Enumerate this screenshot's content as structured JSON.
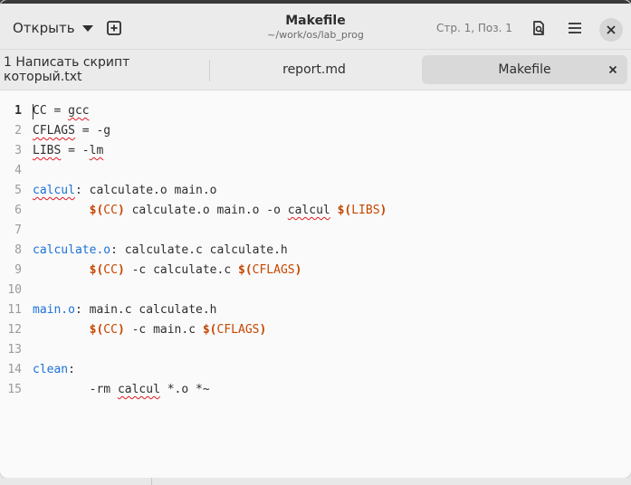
{
  "header": {
    "open_label": "Открыть",
    "title": "Makefile",
    "subtitle": "~/work/os/lab_prog",
    "position": "Стр. 1, Поз. 1"
  },
  "icons": {
    "new_tab": "new-tab-icon",
    "document_search": "document-search-icon",
    "menu": "hamburger-menu-icon",
    "close": "close-icon"
  },
  "tabs": [
    {
      "label": "1 Написать скрипт который.txt",
      "active": false
    },
    {
      "label": "report.md",
      "active": false
    },
    {
      "label": "Makefile",
      "active": true
    }
  ],
  "editor": {
    "line_numbers": [
      "1",
      "2",
      "3",
      "4",
      "5",
      "6",
      "7",
      "8",
      "9",
      "10",
      "11",
      "12",
      "13",
      "14",
      "15"
    ],
    "current_line": "1"
  },
  "code_lines": {
    "l1": {
      "a": "CC",
      "b": " = ",
      "c": "gcc"
    },
    "l2": {
      "a": "CFLAGS",
      "b": " = -g"
    },
    "l3": {
      "a": "LIBS",
      "b": " = -",
      "c": "lm"
    },
    "l5": {
      "target": "calcul",
      "rest": ": calculate.o main.o"
    },
    "l6": {
      "indent": "        ",
      "d1": "$(",
      "v1": "CC",
      "d2": ")",
      "mid": " calculate.o main.o -o ",
      "sp": "calcul",
      "sp2": " ",
      "d3": "$(",
      "v2": "LIBS",
      "d4": ")"
    },
    "l8": {
      "target": "calculate.o",
      "rest": ": calculate.c calculate.h"
    },
    "l9": {
      "indent": "        ",
      "d1": "$(",
      "v1": "CC",
      "d2": ")",
      "mid": " -c calculate.c ",
      "d3": "$(",
      "v2": "CFLAGS",
      "d4": ")"
    },
    "l11": {
      "target": "main.o",
      "rest": ": main.c calculate.h"
    },
    "l12": {
      "indent": "        ",
      "d1": "$(",
      "v1": "CC",
      "d2": ")",
      "mid": " -c main.c ",
      "d3": "$(",
      "v2": "CFLAGS",
      "d4": ")"
    },
    "l14": {
      "target": "clean",
      "rest": ":"
    },
    "l15": {
      "indent": "        ",
      "pre": "-rm ",
      "sp": "calcul",
      "post": " *.o *~"
    }
  },
  "colors": {
    "target": "#1c71d8",
    "variable": "#c64600",
    "spell_error": "#e01b24"
  }
}
